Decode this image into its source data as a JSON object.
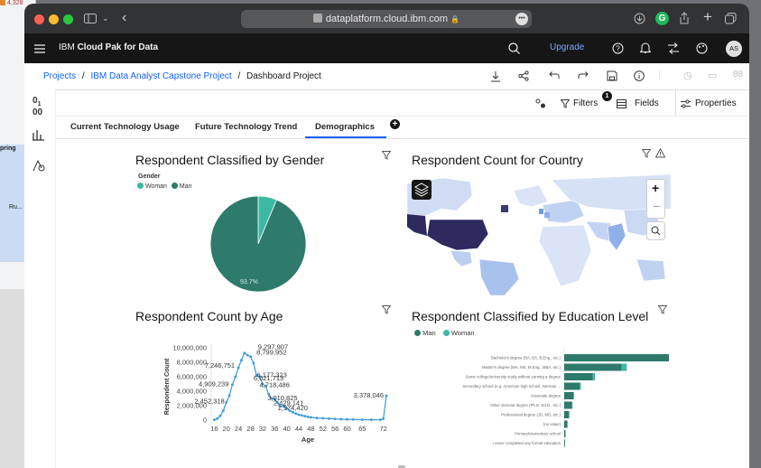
{
  "background": {
    "label_1": "4,328",
    "label_2": "pring",
    "label_3": "Ru..."
  },
  "browser": {
    "url": "dataplatform.cloud.ibm.com",
    "lock": "🔒",
    "more": "•••"
  },
  "app": {
    "brand_prefix": "IBM",
    "brand_name": "Cloud Pak for Data",
    "upgrade": "Upgrade",
    "avatar": "AS"
  },
  "breadcrumb": {
    "projects": "Projects",
    "project": "IBM Data Analyst Capstone Project",
    "current": "Dashboard Project",
    "sep": "/"
  },
  "toolbar": {
    "filters": "Filters",
    "filter_count": "1",
    "fields": "Fields",
    "properties": "Properties"
  },
  "tabs": [
    {
      "label": "Current Technology Usage"
    },
    {
      "label": "Future Technology Trend"
    },
    {
      "label": "Demographics"
    }
  ],
  "gender_panel": {
    "title": "Respondent Classified by Gender",
    "legend_title": "Gender",
    "legend": [
      "Woman",
      "Man"
    ],
    "slice_label": "93.7%"
  },
  "country_panel": {
    "title": "Respondent Count for Country"
  },
  "age_panel": {
    "title": "Respondent Count by Age"
  },
  "education_panel": {
    "title": "Respondent Classified by Education Level",
    "legend": [
      "Man",
      "Woman"
    ]
  },
  "chart_data": [
    {
      "type": "pie",
      "title": "Respondent Classified by Gender",
      "legend_title": "Gender",
      "slices": [
        {
          "name": "Man",
          "value": 93.7,
          "color": "#2e7a6b"
        },
        {
          "name": "Woman",
          "value": 6.3,
          "color": "#3cb8a3"
        }
      ],
      "data_labels": [
        "93.7%"
      ]
    },
    {
      "type": "line",
      "title": "Respondent Count by Age",
      "xlabel": "Age",
      "ylabel": "Respondent Count",
      "xlim": [
        15,
        73
      ],
      "ylim": [
        0,
        10000000
      ],
      "xticks": [
        "16",
        "20",
        "24",
        "28",
        "32",
        "36",
        "40",
        "44",
        "48",
        "52",
        "56",
        "60",
        "65",
        "72"
      ],
      "yticks": [
        "0",
        "2,000,000",
        "4,000,000",
        "6,000,000",
        "8,000,000",
        "10,000,000"
      ],
      "series": [
        {
          "x": [
            16,
            17,
            18,
            19,
            20,
            21,
            22,
            23,
            24,
            25,
            26,
            27,
            28,
            29,
            30,
            31,
            32,
            33,
            34,
            35,
            36,
            37,
            38,
            39,
            40,
            41,
            42,
            43,
            44,
            45,
            46,
            47,
            48,
            50,
            52,
            54,
            56,
            58,
            60,
            62,
            65,
            68,
            71,
            72,
            73
          ],
          "y": [
            50000,
            200000,
            600000,
            1300000,
            2452318,
            3400000,
            4909239,
            6000000,
            7246751,
            8300000,
            9297907,
            9000000,
            8799952,
            7900000,
            6177323,
            6021713,
            5000000,
            4718486,
            3600000,
            3010825,
            2900000,
            2429141,
            1900000,
            1974420,
            1600000,
            1300000,
            1100000,
            900000,
            750000,
            650000,
            550000,
            450000,
            380000,
            300000,
            250000,
            200000,
            160000,
            130000,
            100000,
            80000,
            60000,
            50000,
            40000,
            200000,
            3378046
          ]
        }
      ],
      "data_labels": [
        "9,297,907",
        "8,799,952",
        "7,246,751",
        "6,177,323",
        "6,021,713",
        "4,909,239",
        "4,718,486",
        "3,010,825",
        "2,429,141",
        "1,974,420",
        "2,452,318",
        "3,378,046"
      ]
    },
    {
      "type": "bar",
      "title": "Respondent Classified by Education Level",
      "categories": [
        "Bachelor's degree (BA, BS, B.Eng., etc.)",
        "Master's degree (MA, MS, M.Eng., MBA, etc.)",
        "Some college/university study without earning a degree",
        "Secondary school (e.g. American high school, German ...",
        "Associate degree",
        "Other doctoral degree (Ph.D, Ed.D., etc.)",
        "Professional degree (JD, MD, etc.)",
        "(no value)",
        "Primary/elementary school",
        "I never completed any formal education"
      ],
      "series": [
        {
          "name": "Man",
          "values": [
            41,
            22,
            11,
            6,
            3.5,
            3,
            1.8,
            1.2,
            0.5,
            0.3
          ],
          "color": "#2e7a6b"
        },
        {
          "name": "Woman",
          "values": [
            3.5,
            2,
            0.8,
            0.4,
            0.3,
            0.2,
            0.2,
            0.1,
            0.05,
            0.05
          ],
          "color": "#3cb8a3"
        }
      ]
    }
  ],
  "colors": {
    "ibm_header": "#161616",
    "accent": "#0f62fe",
    "man": "#2e7a6b",
    "woman": "#3cb8a3",
    "usa": "#2e2a5f"
  }
}
